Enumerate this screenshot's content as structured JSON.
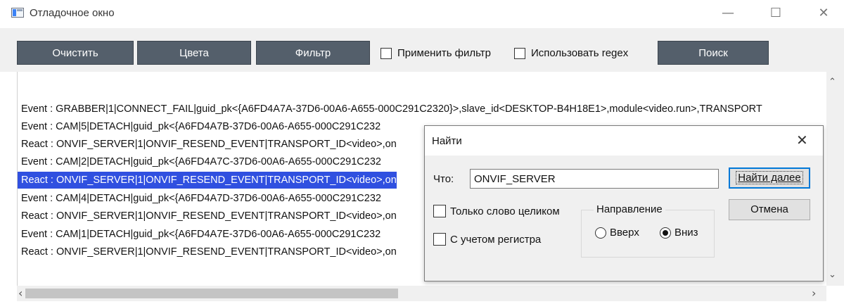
{
  "window": {
    "title": "Отладочное окно",
    "controls": {
      "minimize": "—",
      "maximize": "☐",
      "close": "✕"
    }
  },
  "toolbar": {
    "clear_label": "Очистить",
    "colors_label": "Цвета",
    "filter_label": "Фильтр",
    "apply_filter_label": "Применить фильтр",
    "use_regex_label": "Использовать regex",
    "search_label": "Поиск",
    "apply_filter_checked": false,
    "use_regex_checked": false
  },
  "log": {
    "lines": [
      "Event : GRABBER|1|CONNECT_FAIL|guid_pk<{A6FD4A7A-37D6-00A6-A655-000C291C2320}>,slave_id<DESKTOP-B4H18E1>,module<video.run>,TRANSPORT",
      "Event : CAM|5|DETACH|guid_pk<{A6FD4A7B-37D6-00A6-A655-000C291C232",
      "React : ONVIF_SERVER|1|ONVIF_RESEND_EVENT|TRANSPORT_ID<video>,on",
      "Event : CAM|2|DETACH|guid_pk<{A6FD4A7C-37D6-00A6-A655-000C291C232",
      "React : ONVIF_SERVER|1|ONVIF_RESEND_EVENT|TRANSPORT_ID<video>,on",
      "Event : CAM|4|DETACH|guid_pk<{A6FD4A7D-37D6-00A6-A655-000C291C232",
      "React : ONVIF_SERVER|1|ONVIF_RESEND_EVENT|TRANSPORT_ID<video>,on",
      "Event : CAM|1|DETACH|guid_pk<{A6FD4A7E-37D6-00A6-A655-000C291C232",
      "React : ONVIF_SERVER|1|ONVIF_RESEND_EVENT|TRANSPORT_ID<video>,on"
    ],
    "selected_index": 4,
    "selection_color": "#3050e0"
  },
  "scrollbars": {
    "up_arrow": "⌃",
    "down_arrow": "⌄",
    "left_arrow": "‹",
    "right_arrow": "›"
  },
  "find_dialog": {
    "title": "Найти",
    "close_glyph": "✕",
    "what_label": "Что:",
    "what_value": "ONVIF_SERVER",
    "find_next_label": "Найти далее",
    "cancel_label": "Отмена",
    "whole_word_label": "Только слово целиком",
    "match_case_label": "С учетом регистра",
    "whole_word_checked": false,
    "match_case_checked": false,
    "direction_label": "Направление",
    "up_label": "Вверх",
    "down_label": "Вниз",
    "direction_selected": "down"
  },
  "colors": {
    "toolbar_button": "#545f6b",
    "selection": "#3050e0",
    "default_button_border": "#0078d7"
  }
}
